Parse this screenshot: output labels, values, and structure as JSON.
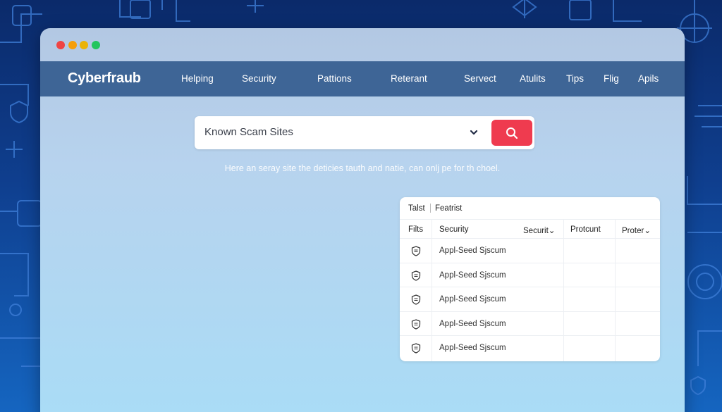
{
  "window": {
    "controls": [
      {
        "name": "close",
        "color": "#ef4444"
      },
      {
        "name": "minimize",
        "color": "#f59e0b"
      },
      {
        "name": "extra",
        "color": "#eab308"
      },
      {
        "name": "maximize",
        "color": "#22c55e"
      }
    ]
  },
  "header": {
    "brand": "Cyberfraub",
    "nav": [
      "Helping",
      "Security",
      "Pattions",
      "Reterant",
      "Servect",
      "Atulits",
      "Tips",
      "Flig",
      "Apils"
    ]
  },
  "search": {
    "value": "Known Scam Sites",
    "dropdown_icon": "chevron-down-icon",
    "button_icon": "search-icon",
    "button_color": "#ef3b4f"
  },
  "subtext": "Here an seray site the deticies tauth and natie, can onlj pe for th choel.",
  "table": {
    "tabs": [
      "Talst",
      "Featrist"
    ],
    "columns": [
      "Filts",
      "Security",
      "Securit⌄",
      "Protcunt",
      "Proter⌄"
    ],
    "rows": [
      {
        "icon": "shield-icon",
        "text": "Appl-Seed Sjscum"
      },
      {
        "icon": "shield-icon",
        "text": "Appl-Seed Sjscum"
      },
      {
        "icon": "shield-icon",
        "text": "Appl-Seed Sjscum"
      },
      {
        "icon": "shield-icon",
        "text": "Appl-Seed Sjscum"
      },
      {
        "icon": "shield-icon",
        "text": "Appl-Seed Sjscum"
      }
    ]
  },
  "colors": {
    "navbar": "#3e6596",
    "accent": "#ef3b4f",
    "background": "#0f3f8f"
  }
}
